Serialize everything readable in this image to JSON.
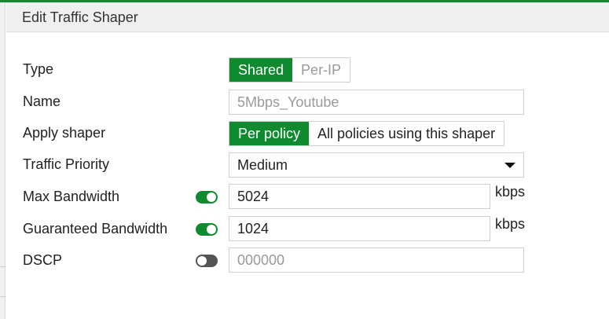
{
  "colors": {
    "accent": "#0f8a2f",
    "toggle_off": "#555555"
  },
  "dialog": {
    "title": "Edit Traffic Shaper"
  },
  "form": {
    "type": {
      "label": "Type",
      "options": [
        "Shared",
        "Per-IP"
      ],
      "selected": "Shared"
    },
    "name": {
      "label": "Name",
      "placeholder": "5Mbps_Youtube"
    },
    "apply_shaper": {
      "label": "Apply shaper",
      "options": [
        "Per policy",
        "All policies using this shaper"
      ],
      "selected": "Per policy"
    },
    "traffic_priority": {
      "label": "Traffic Priority",
      "value": "Medium"
    },
    "max_bandwidth": {
      "label": "Max Bandwidth",
      "enabled": true,
      "value": "5024",
      "unit": "kbps"
    },
    "guaranteed_bandwidth": {
      "label": "Guaranteed Bandwidth",
      "enabled": true,
      "value": "1024",
      "unit": "kbps"
    },
    "dscp": {
      "label": "DSCP",
      "enabled": false,
      "placeholder": "000000"
    }
  },
  "icons": {
    "toggle_on": "toggle-on-icon",
    "toggle_off": "toggle-off-icon",
    "dropdown": "chevron-down-icon"
  }
}
